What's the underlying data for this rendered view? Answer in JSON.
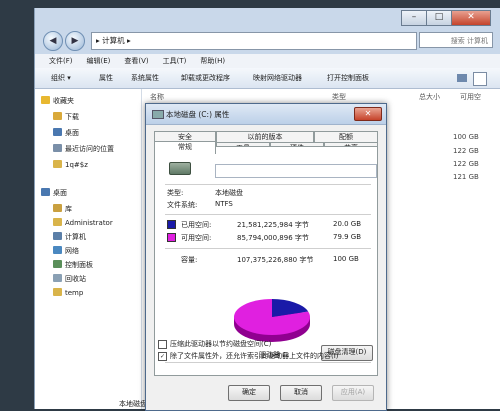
{
  "explorer": {
    "address": "▸ 计算机 ▸",
    "search_placeholder": "搜索 计算机",
    "menu": [
      "文件(F)",
      "编辑(E)",
      "查看(V)",
      "工具(T)",
      "帮助(H)"
    ],
    "toolbar": [
      "组织 ▾",
      "属性",
      "系统属性",
      "卸载或更改程序",
      "映射网络驱动器",
      "打开控制面板"
    ],
    "nav": [
      {
        "label": "收藏夹",
        "icon": "star-icon",
        "color": "#e8b830"
      },
      {
        "label": "下载",
        "icon": "download-folder-icon",
        "color": "#d9a93a"
      },
      {
        "label": "桌面",
        "icon": "desktop-icon",
        "color": "#4a78b0"
      },
      {
        "label": "最近访问的位置",
        "icon": "recent-places-icon",
        "color": "#7a8fa8"
      },
      {
        "label": "1q#$z",
        "icon": "folder-icon",
        "color": "#d9b44a"
      },
      {
        "label": "桌面",
        "icon": "desktop-icon",
        "color": "#4a78b0"
      },
      {
        "label": "库",
        "icon": "library-icon",
        "color": "#c9a040"
      },
      {
        "label": "Administrator",
        "icon": "user-folder-icon",
        "color": "#d9b44a"
      },
      {
        "label": "计算机",
        "icon": "computer-icon",
        "color": "#5b7fa8"
      },
      {
        "label": "网络",
        "icon": "network-icon",
        "color": "#4a88c0"
      },
      {
        "label": "控制面板",
        "icon": "control-panel-icon",
        "color": "#5a8f5a"
      },
      {
        "label": "回收站",
        "icon": "recycle-bin-icon",
        "color": "#8aa0b4"
      },
      {
        "label": "temp",
        "icon": "folder-icon",
        "color": "#d9b44a"
      }
    ],
    "columns": [
      "名称",
      "类型",
      "总大小",
      "可用空"
    ],
    "sizes": [
      "100 GB",
      "122 GB",
      "122 GB",
      "121 GB"
    ],
    "status": "本地磁盘 (C:)"
  },
  "dialog": {
    "title": "本地磁盘 (C:) 属性",
    "close_glyph": "✕",
    "tabs_top": [
      "安全",
      "以前的版本",
      "配额"
    ],
    "tabs_bottom": [
      "常规",
      "工具",
      "硬件",
      "共享"
    ],
    "type_label": "类型:",
    "type_value": "本地磁盘",
    "fs_label": "文件系统:",
    "fs_value": "NTFS",
    "used": {
      "label": "已用空间:",
      "bytes": "21,581,225,984 字节",
      "size": "20.0 GB",
      "color": "#1a1aa8"
    },
    "free": {
      "label": "可用空间:",
      "bytes": "85,794,000,896 字节",
      "size": "79.9 GB",
      "color": "#e020e0"
    },
    "capacity": {
      "label": "容量:",
      "bytes": "107,375,226,880 字节",
      "size": "100 GB"
    },
    "drive_label": "驱动器 C:",
    "cleanup_button": "磁盘清理(D)",
    "checkbox_compress": "压缩此驱动器以节约磁盘空间(C)",
    "checkbox_index": "除了文件属性外，还允许索引此驱动器上文件的内容(I)",
    "compress_checked": false,
    "index_checked": true,
    "ok_button": "确定",
    "cancel_button": "取消",
    "apply_button": "应用(A)"
  }
}
